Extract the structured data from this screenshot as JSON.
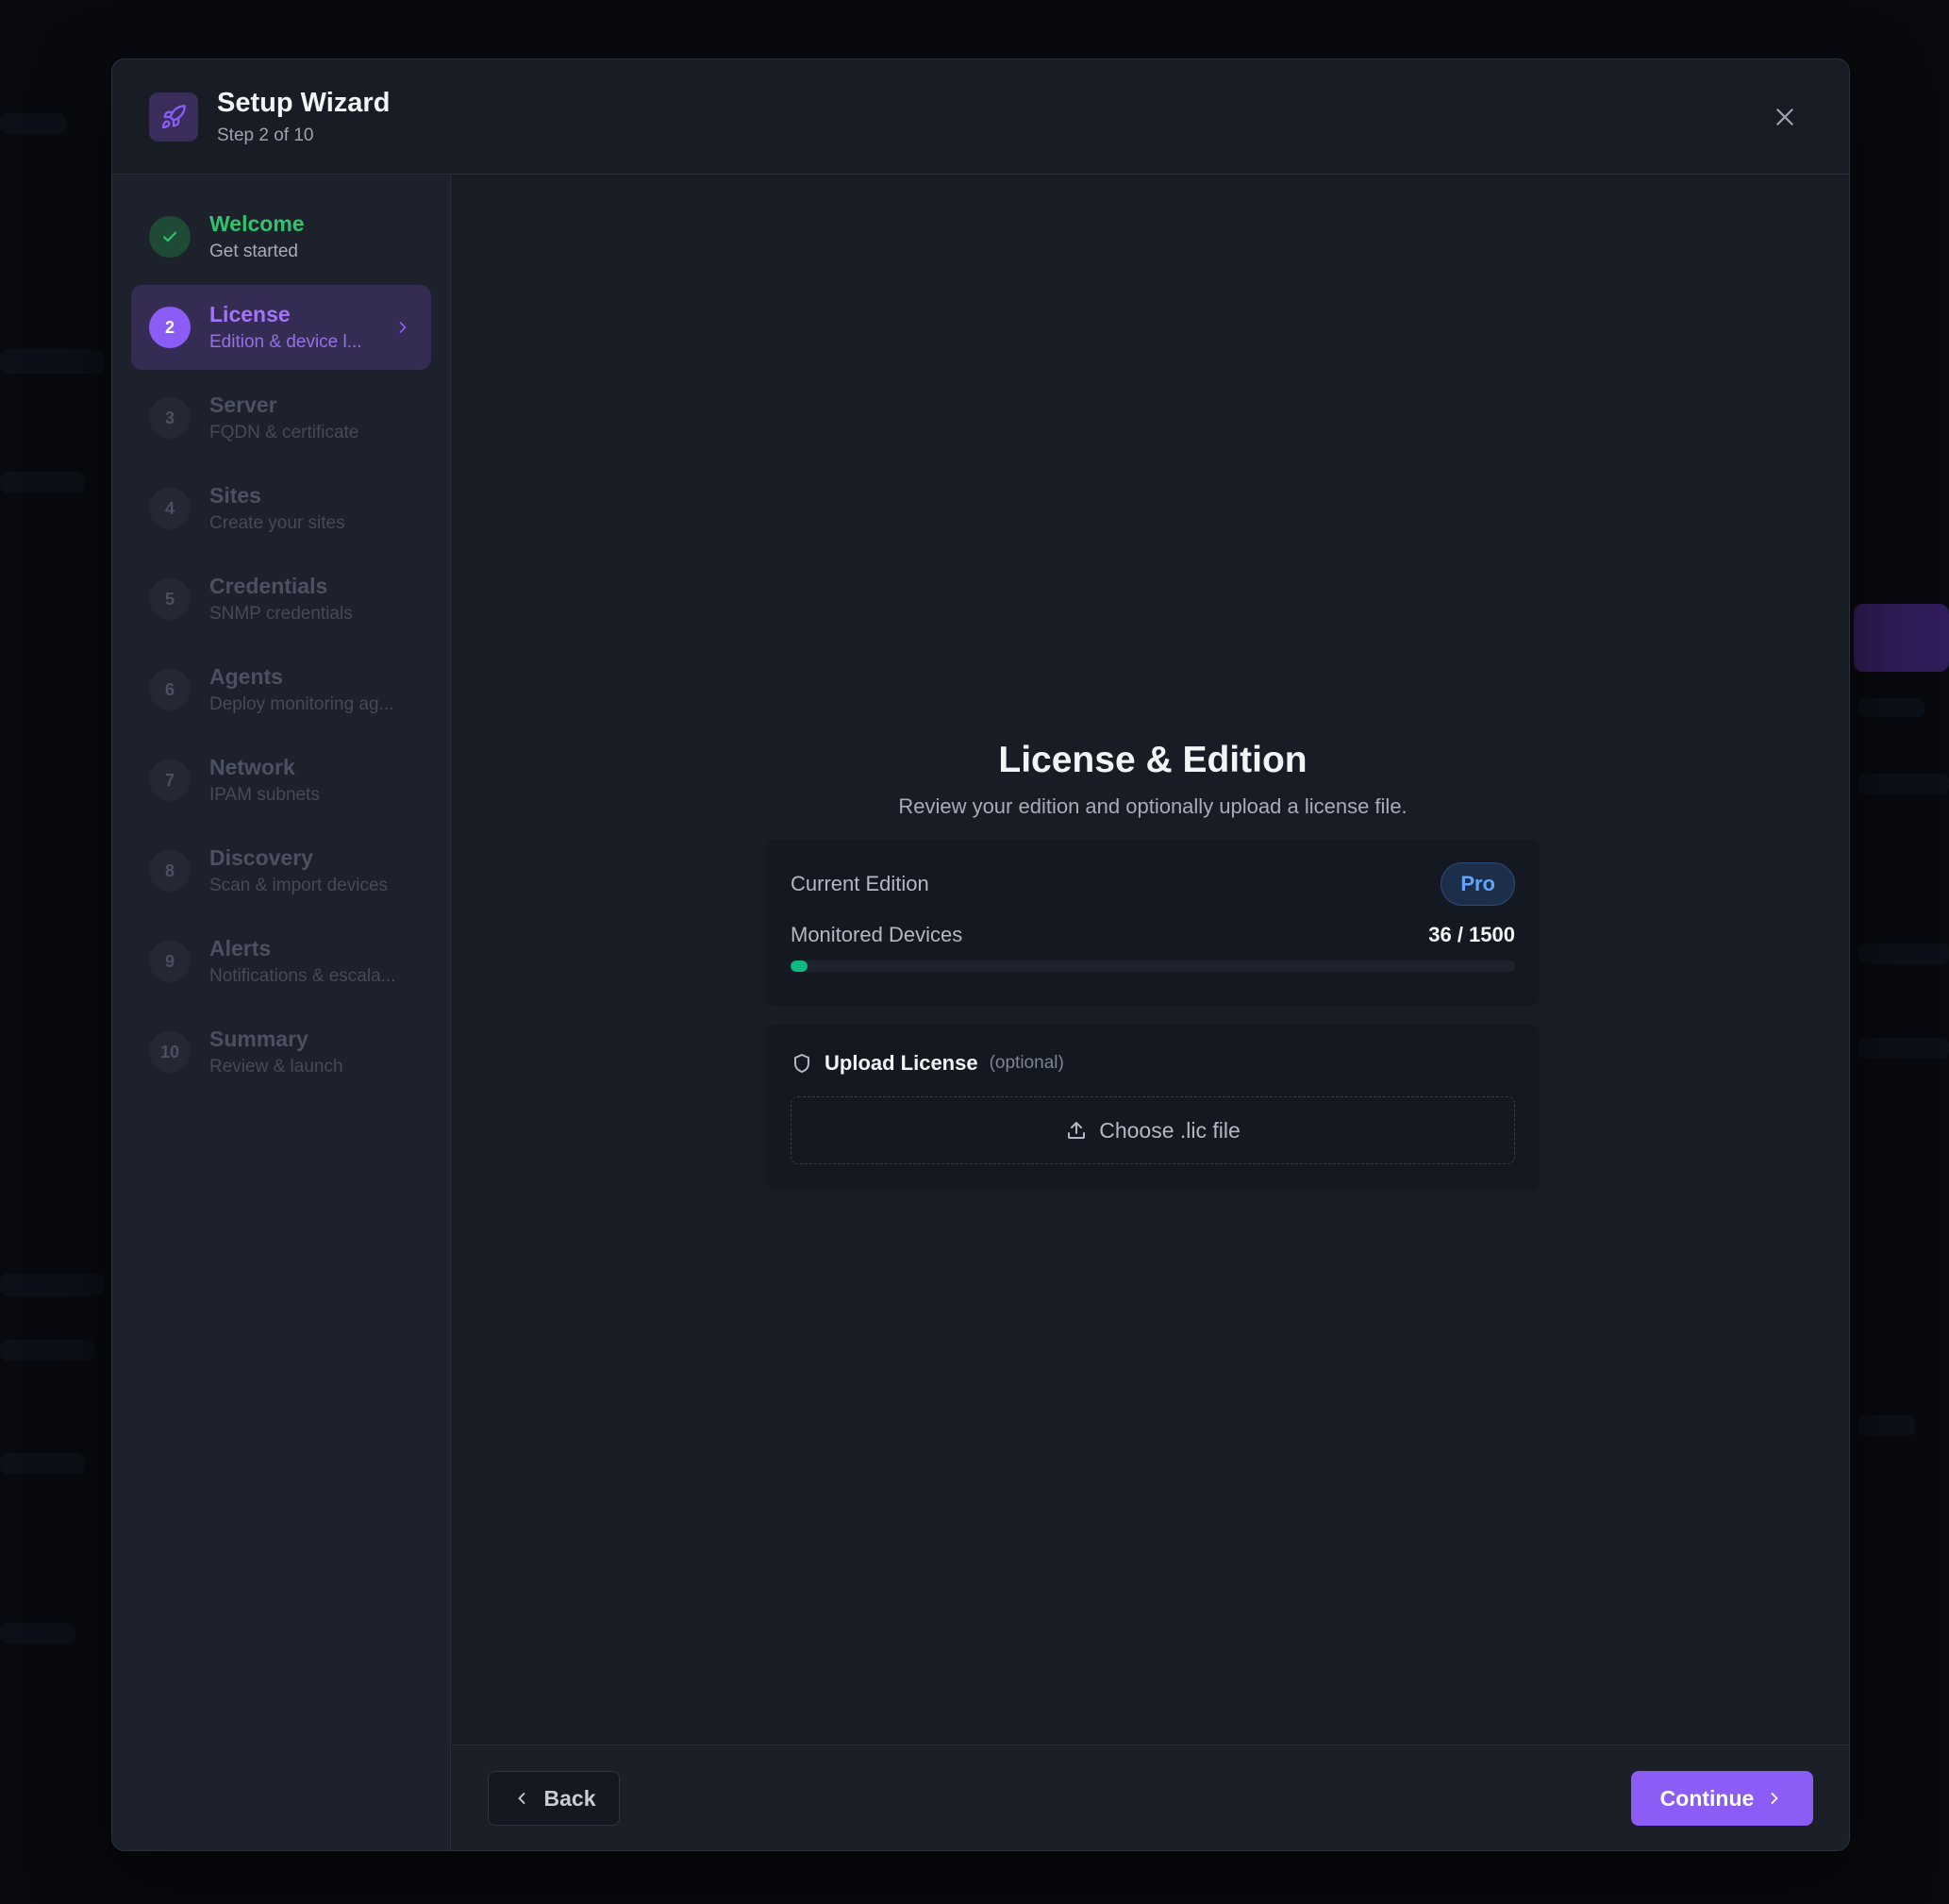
{
  "wizard": {
    "title": "Setup Wizard",
    "step_indicator": "Step 2 of 10"
  },
  "steps": [
    {
      "number": "1",
      "label": "Welcome",
      "desc": "Get started",
      "state": "done"
    },
    {
      "number": "2",
      "label": "License",
      "desc": "Edition & device l...",
      "state": "active"
    },
    {
      "number": "3",
      "label": "Server",
      "desc": "FQDN & certificate",
      "state": "pending"
    },
    {
      "number": "4",
      "label": "Sites",
      "desc": "Create your sites",
      "state": "pending"
    },
    {
      "number": "5",
      "label": "Credentials",
      "desc": "SNMP credentials",
      "state": "pending"
    },
    {
      "number": "6",
      "label": "Agents",
      "desc": "Deploy monitoring ag...",
      "state": "pending"
    },
    {
      "number": "7",
      "label": "Network",
      "desc": "IPAM subnets",
      "state": "pending"
    },
    {
      "number": "8",
      "label": "Discovery",
      "desc": "Scan & import devices",
      "state": "pending"
    },
    {
      "number": "9",
      "label": "Alerts",
      "desc": "Notifications & escala...",
      "state": "pending"
    },
    {
      "number": "10",
      "label": "Summary",
      "desc": "Review & launch",
      "state": "pending"
    }
  ],
  "panel": {
    "title": "License & Edition",
    "subtitle": "Review your edition and optionally upload a license file.",
    "edition_label": "Current Edition",
    "edition_value": "Pro",
    "devices_label": "Monitored Devices",
    "devices_value": "36 / 1500",
    "devices_used": 36,
    "devices_limit": 1500,
    "upload_title": "Upload License",
    "upload_optional": "(optional)",
    "file_button_label": "Choose .lic file"
  },
  "footer": {
    "back_label": "Back",
    "continue_label": "Continue"
  },
  "colors": {
    "accent": "#8b5cf6",
    "success": "#2fc46b",
    "progress": "#10b981",
    "badge_text": "#60a5fa"
  },
  "icons": {
    "logo": "rocket-icon",
    "close": "close-icon",
    "done": "check-icon",
    "active_chevron": "chevron-right-icon",
    "upload_head": "shield-icon",
    "file_button": "upload-icon",
    "back": "chevron-left-icon",
    "continue": "chevron-right-icon"
  }
}
